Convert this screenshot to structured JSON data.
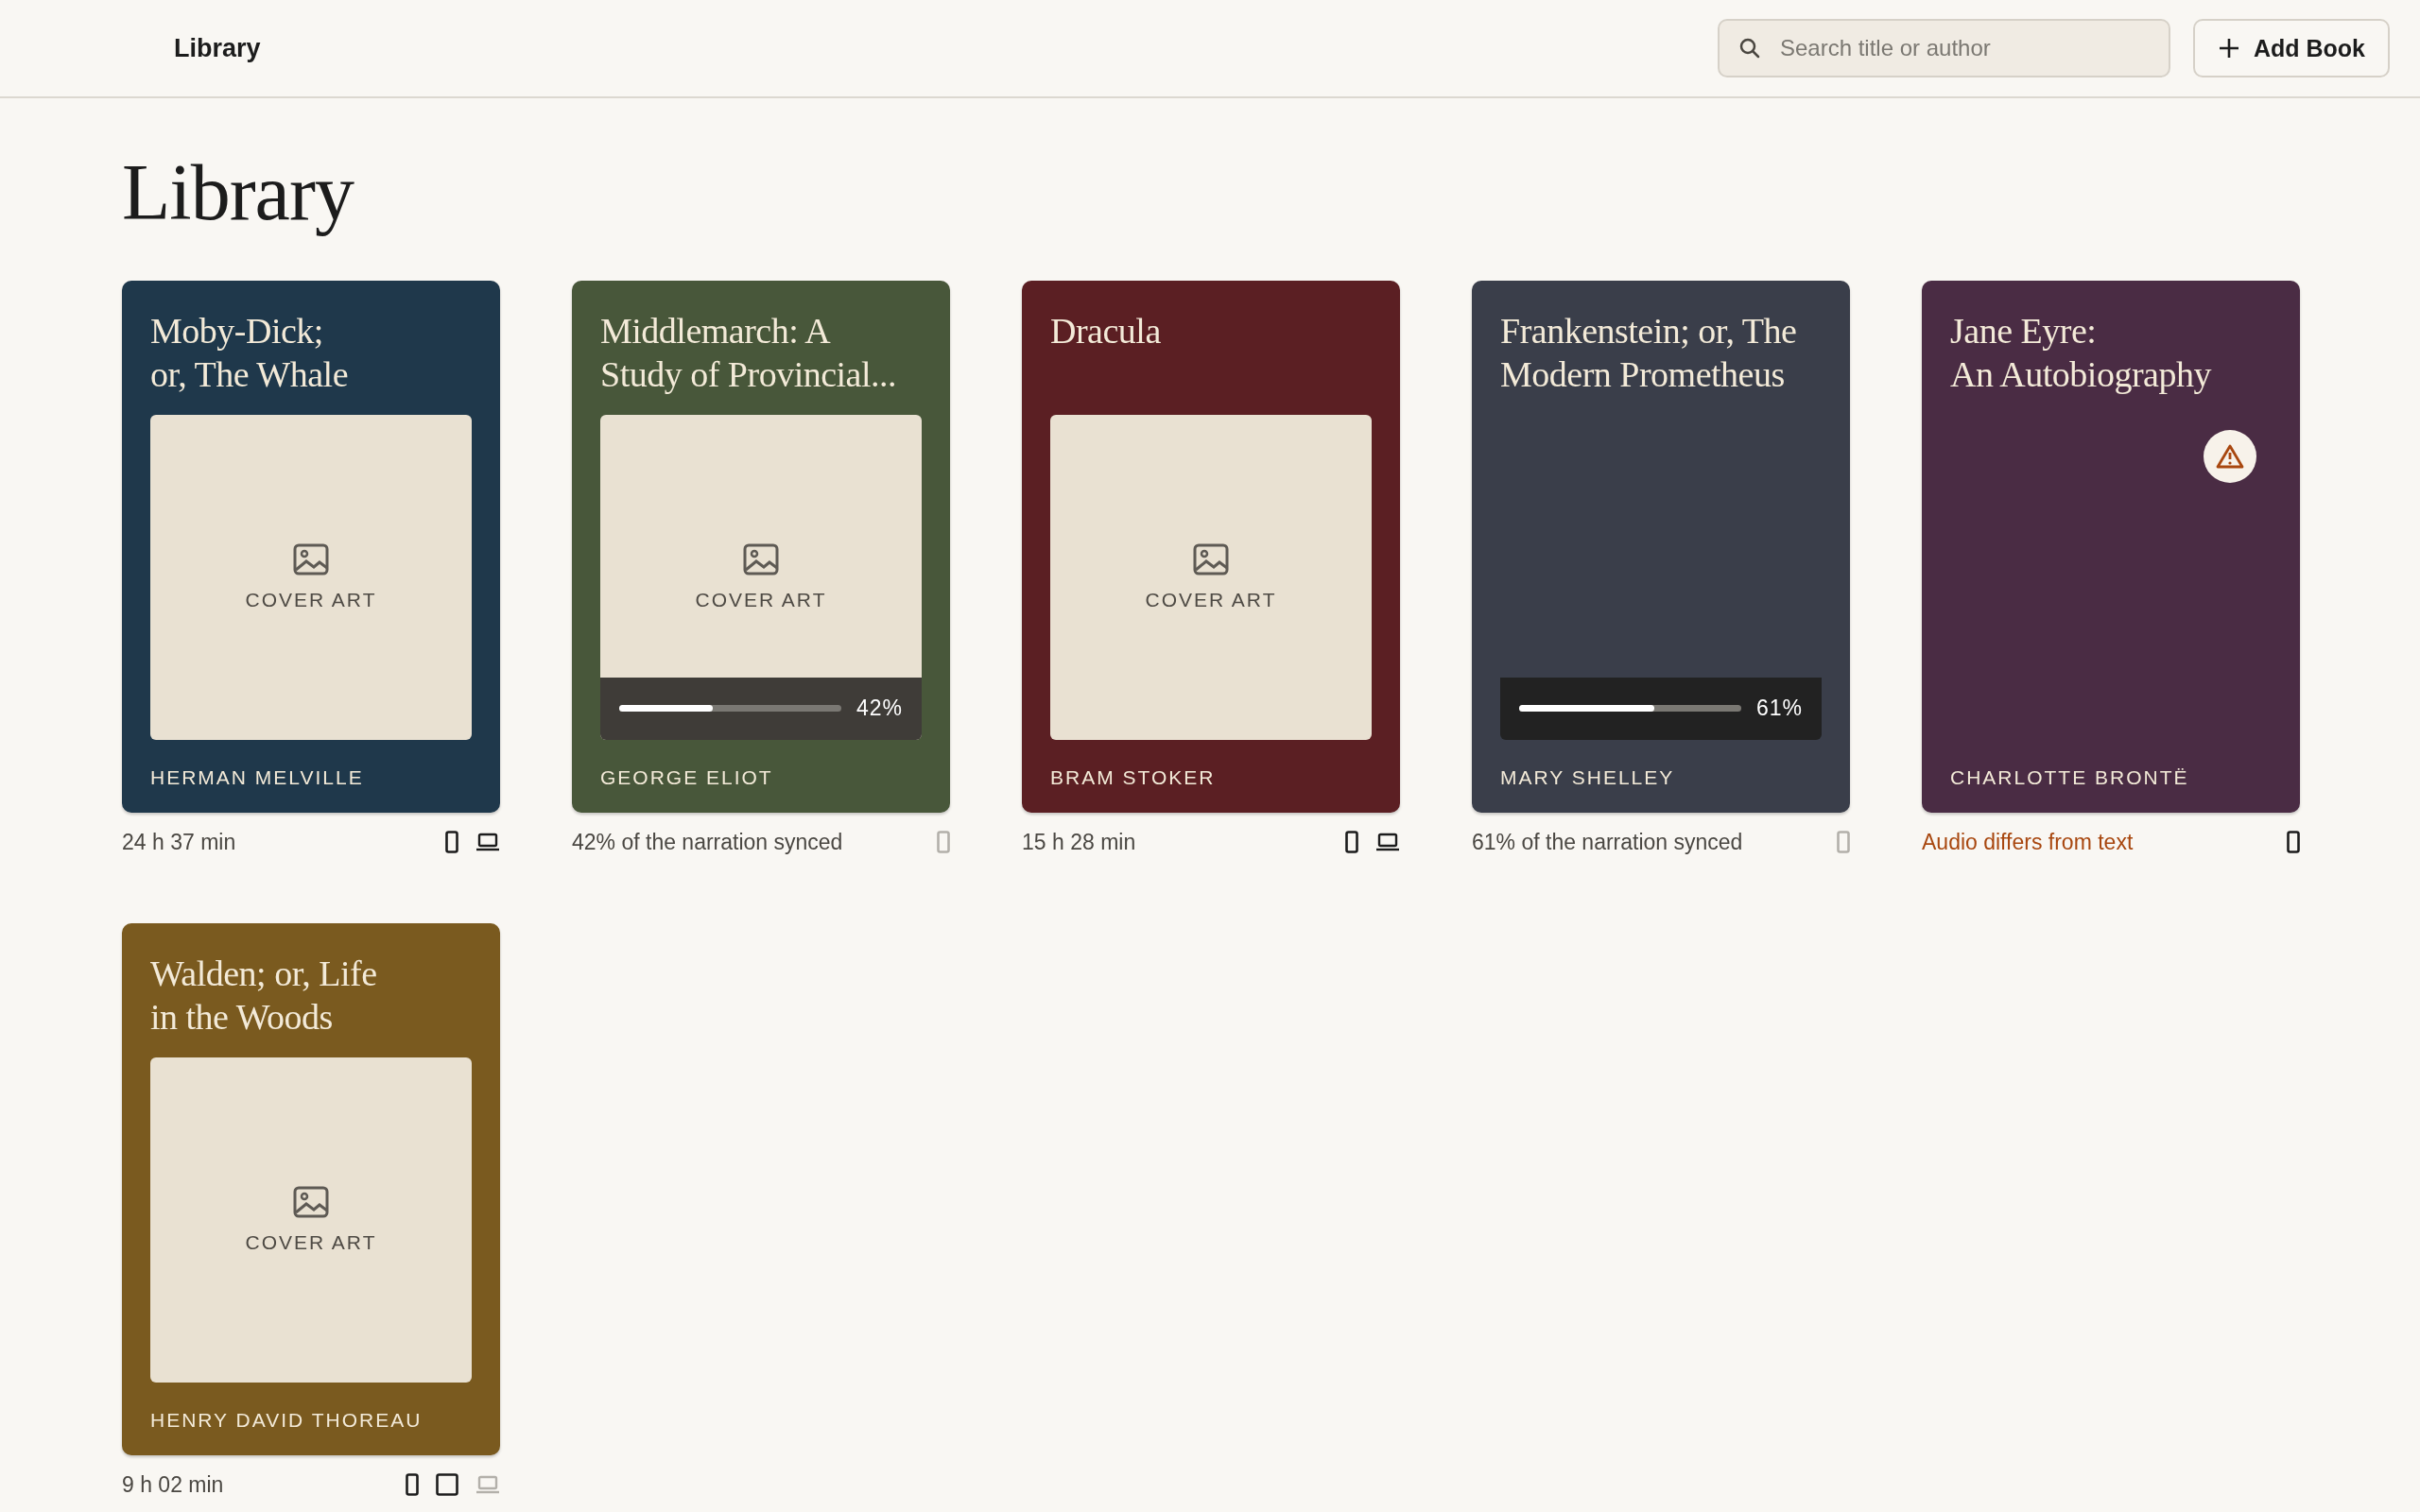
{
  "nav": {
    "title": "Library"
  },
  "search": {
    "placeholder": "Search title or author"
  },
  "add_button": {
    "label": "Add Book"
  },
  "heading": "Library",
  "books": [
    {
      "title": "Moby-Dick;\nor, The Whale",
      "author": "HERMAN MELVILLE",
      "color": "#1f384b",
      "cover": {
        "label": "COVER ART"
      },
      "footer": {
        "kind": "duration",
        "text": "24 h 37 min"
      },
      "devices": [
        {
          "kind": "phone",
          "available": true
        },
        {
          "kind": "laptop",
          "available": true
        }
      ]
    },
    {
      "title": "Middlemarch: A\nStudy of Provincial...",
      "author": "GEORGE ELIOT",
      "color": "#48573a",
      "cover": {
        "label": "COVER ART"
      },
      "sync": {
        "level": 0.42,
        "label": "42%"
      },
      "footer": {
        "kind": "sync",
        "text": "42% of the narration synced"
      },
      "devices": [
        {
          "kind": "phone",
          "available": false
        }
      ]
    },
    {
      "title": "Dracula",
      "author": "BRAM STOKER",
      "color": "#5b1f23",
      "cover": {
        "label": "COVER ART"
      },
      "footer": {
        "kind": "duration",
        "text": "15 h 28 min"
      },
      "devices": [
        {
          "kind": "phone",
          "available": true
        },
        {
          "kind": "laptop",
          "available": true
        }
      ]
    },
    {
      "title": "Frankenstein; or, The\nModern Prometheus",
      "author": "MARY SHELLEY",
      "color": "#3a3e4a",
      "sync": {
        "level": 0.61,
        "label": "61%"
      },
      "footer": {
        "kind": "sync",
        "text": "61% of the narration synced"
      },
      "devices": [
        {
          "kind": "phone",
          "available": false
        }
      ]
    },
    {
      "title": "Jane Eyre:\nAn Autobiography",
      "author": "CHARLOTTE BRONTË",
      "color": "#4a2c44",
      "warning": true,
      "footer": {
        "kind": "warning",
        "text": "Audio differs from text"
      },
      "devices": [
        {
          "kind": "phone",
          "available": true
        }
      ]
    },
    {
      "title": "Walden; or, Life\nin the Woods",
      "author": "HENRY DAVID THOREAU",
      "color": "#7a5a1f",
      "cover": {
        "label": "COVER ART"
      },
      "footer": {
        "kind": "duration",
        "text": "9 h 02 min"
      },
      "devices": [
        {
          "kind": "phone",
          "available": true
        },
        {
          "kind": "tablet",
          "available": true
        },
        {
          "kind": "laptop",
          "available": false
        }
      ]
    }
  ]
}
